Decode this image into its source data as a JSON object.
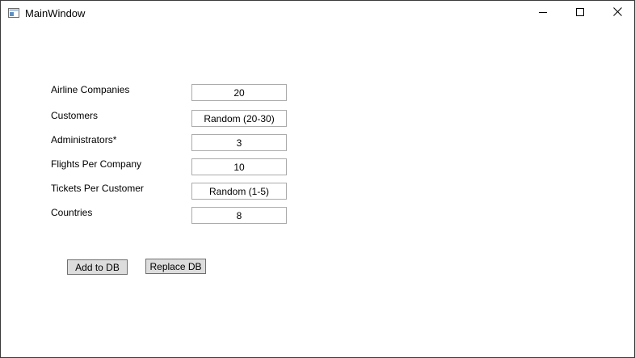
{
  "window": {
    "title": "MainWindow"
  },
  "form": {
    "fields": [
      {
        "label": "Airline Companies",
        "value": "20"
      },
      {
        "label": "Customers",
        "value": "Random (20-30)"
      },
      {
        "label": "Administrators*",
        "value": "3"
      },
      {
        "label": "Flights Per Company",
        "value": "10"
      },
      {
        "label": "Tickets Per Customer",
        "value": "Random (1-5)"
      },
      {
        "label": "Countries",
        "value": "8"
      }
    ]
  },
  "actions": {
    "add_label": "Add to DB",
    "replace_label": "Replace DB"
  },
  "icons": {
    "app": "window-app-icon",
    "minimize": "minimize-icon",
    "maximize": "maximize-icon",
    "close": "close-icon"
  }
}
